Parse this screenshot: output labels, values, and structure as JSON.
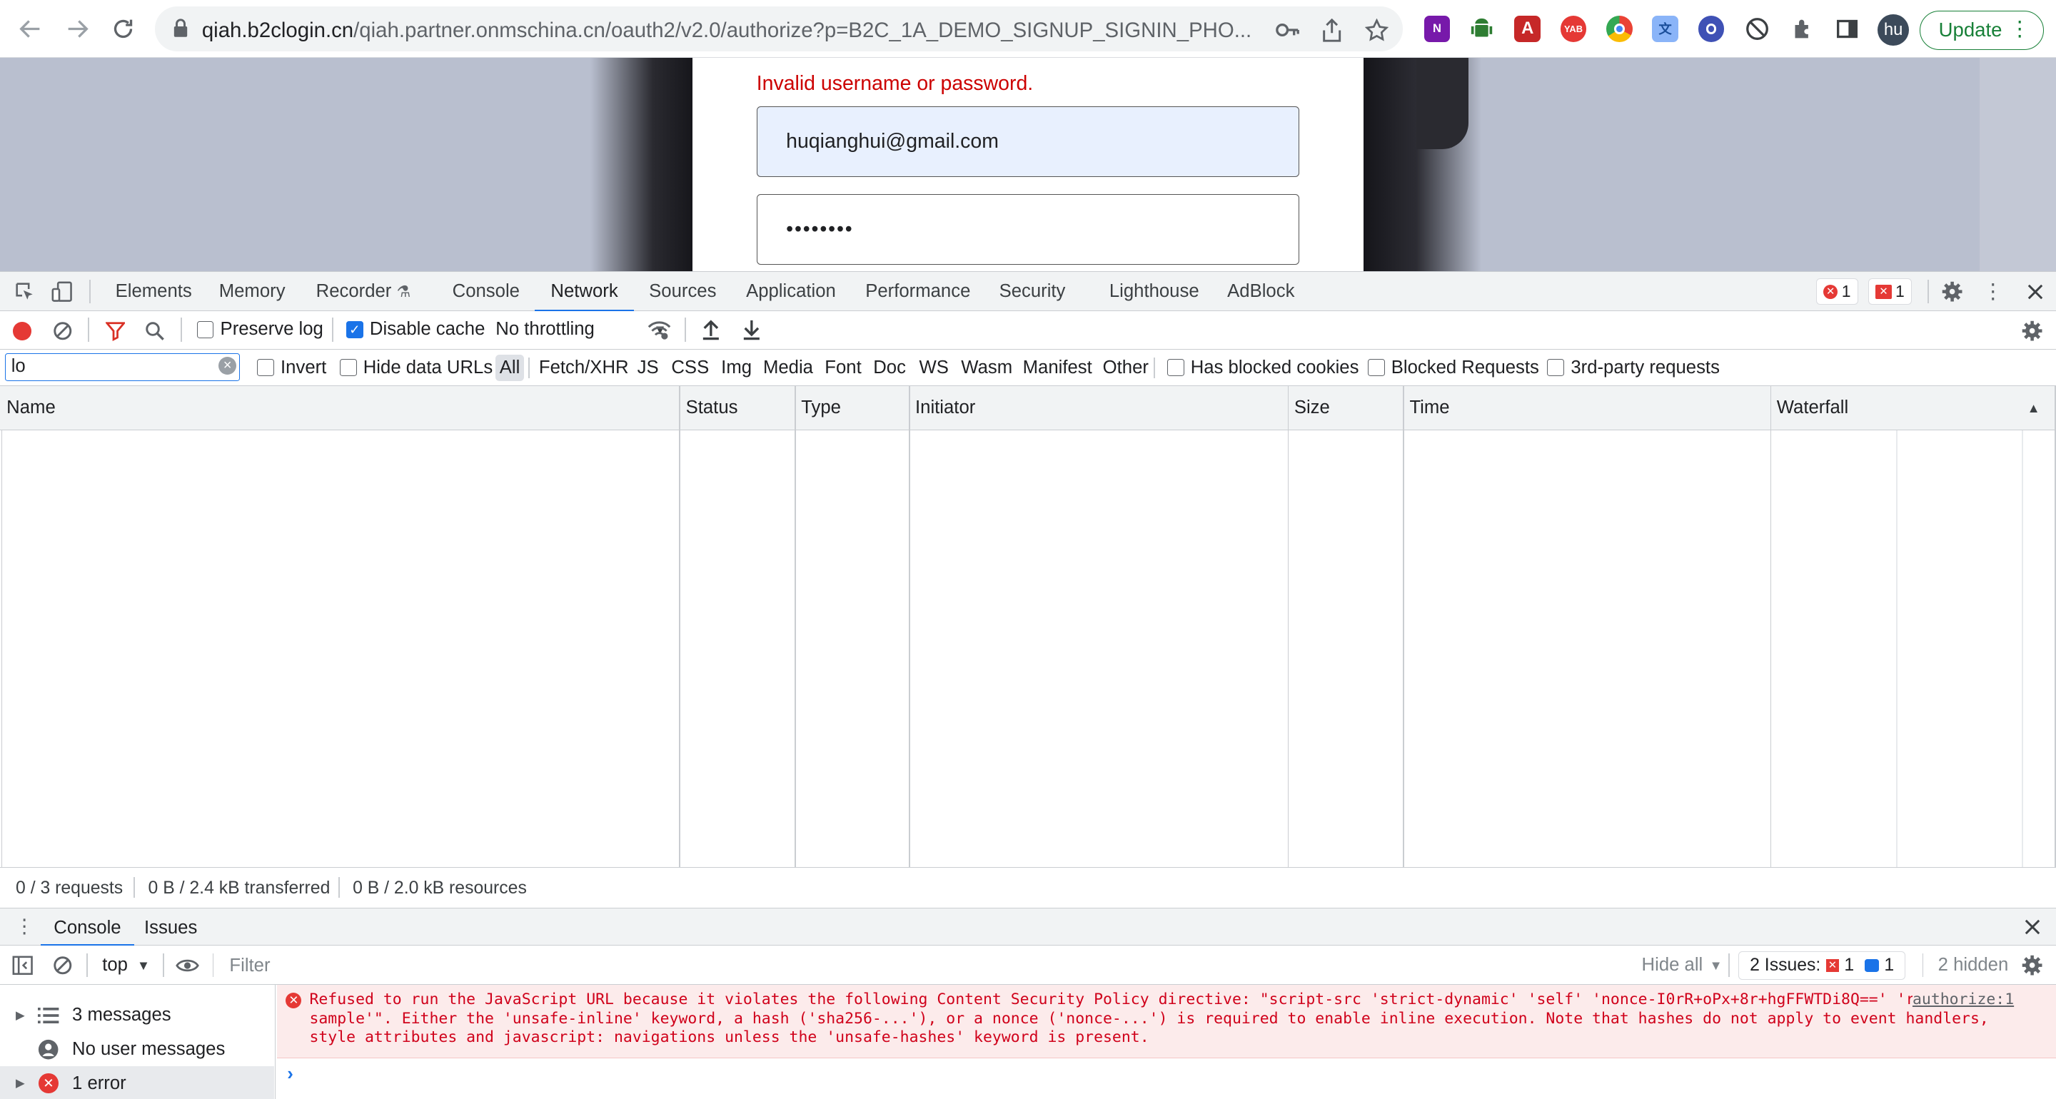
{
  "browser": {
    "url_domain": "qiah.b2clogin.cn",
    "url_path": "/qiah.partner.onmschina.cn/oauth2/v2.0/authorize?p=B2C_1A_DEMO_SIGNUP_SIGNIN_PHO...",
    "profile_initials": "hu",
    "update_label": "Update",
    "extensions": [
      {
        "name": "onenote-extension-icon",
        "label": "N",
        "color": "#7719aa"
      },
      {
        "name": "android-extension-icon",
        "label": "",
        "color": "#2e7d32"
      },
      {
        "name": "acrobat-extension-icon",
        "label": "A",
        "color": "#c62828"
      },
      {
        "name": "yab-extension-icon",
        "label": "YAB",
        "color": "#e53935"
      },
      {
        "name": "chrome-extension-icon",
        "label": "",
        "color": "#fbbc04"
      },
      {
        "name": "translate-extension-icon",
        "label": "",
        "color": "#5b7bd6"
      },
      {
        "name": "compass-extension-icon",
        "label": "",
        "color": "#3f51b5"
      },
      {
        "name": "blocker-extension-icon",
        "label": "",
        "color": "#3c4043"
      }
    ]
  },
  "page": {
    "error_message": "Invalid username or password.",
    "email_value": "huqianghui@gmail.com",
    "password_value": "••••••••"
  },
  "devtools": {
    "tabs": [
      "Elements",
      "Memory",
      "Recorder",
      "Console",
      "Network",
      "Sources",
      "Application",
      "Performance",
      "Security",
      "Lighthouse",
      "AdBlock"
    ],
    "active_tab": "Network",
    "error_count": "1",
    "issue_count": "1",
    "network": {
      "preserve_log_label": "Preserve log",
      "disable_cache_label": "Disable cache",
      "throttling_label": "No throttling",
      "filter_value": "lo",
      "invert_label": "Invert",
      "hide_data_urls_label": "Hide data URLs",
      "types": [
        "All",
        "Fetch/XHR",
        "JS",
        "CSS",
        "Img",
        "Media",
        "Font",
        "Doc",
        "WS",
        "Wasm",
        "Manifest",
        "Other"
      ],
      "selected_type": "All",
      "has_blocked_cookies_label": "Has blocked cookies",
      "blocked_requests_label": "Blocked Requests",
      "third_party_label": "3rd-party requests",
      "columns": [
        "Name",
        "Status",
        "Type",
        "Initiator",
        "Size",
        "Time",
        "Waterfall"
      ],
      "status": {
        "requests": "0 / 3 requests",
        "transferred": "0 B / 2.4 kB transferred",
        "resources": "0 B / 2.0 kB resources"
      }
    },
    "drawer": {
      "tabs": [
        "Console",
        "Issues"
      ],
      "context": "top",
      "filter_placeholder": "Filter",
      "hide_all_label": "Hide all",
      "issues_label": "2 Issues:",
      "issues_error_count": "1",
      "issues_info_count": "1",
      "hidden_label": "2 hidden",
      "sidebar": [
        {
          "label": "3 messages",
          "icon": "list-icon"
        },
        {
          "label": "No user messages",
          "icon": "user-icon"
        },
        {
          "label": "1 error",
          "icon": "error-icon"
        }
      ],
      "error_message": "Refused to run the JavaScript URL because it violates the following Content Security Policy directive: \"script-src 'strict-dynamic' 'self' 'nonce-I0rR+oPx+8r+hgFFWTDi8Q==' 'report-sample'\". Either the 'unsafe-inline' keyword, a hash ('sha256-...'), or a nonce ('nonce-...') is required to enable inline execution. Note that hashes do not apply to event handlers, style attributes and javascript: navigations unless the 'unsafe-hashes' keyword is present.",
      "error_source": "authorize:1"
    }
  }
}
